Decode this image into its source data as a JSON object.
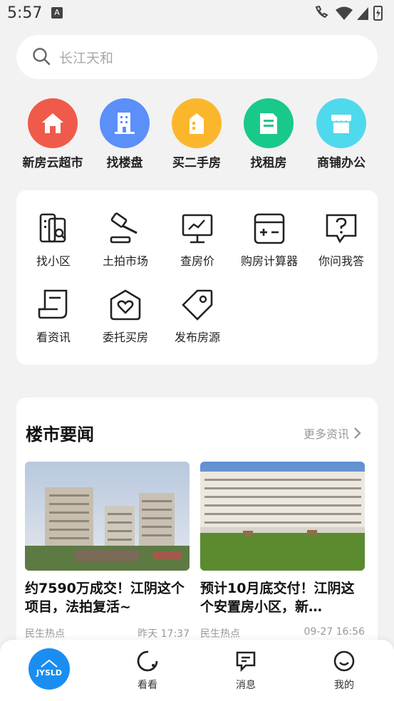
{
  "status_bar": {
    "time": "5:57",
    "notification_icon": "A"
  },
  "search": {
    "placeholder": "长江天和"
  },
  "main_nav": [
    {
      "label": "新房云超市",
      "icon": "house-icon",
      "color": "#f05a4a"
    },
    {
      "label": "找楼盘",
      "icon": "building-icon",
      "color": "#5b8ff9"
    },
    {
      "label": "买二手房",
      "icon": "secondhand-house-icon",
      "color": "#fbb72c"
    },
    {
      "label": "找租房",
      "icon": "rent-document-icon",
      "color": "#19c98a"
    },
    {
      "label": "商铺办公",
      "icon": "shop-icon",
      "color": "#4fd9ec"
    }
  ],
  "tools": [
    {
      "label": "找小区",
      "icon": "community-search-icon"
    },
    {
      "label": "土拍市场",
      "icon": "auction-gavel-icon"
    },
    {
      "label": "查房价",
      "icon": "price-chart-icon"
    },
    {
      "label": "购房计算器",
      "icon": "calculator-icon"
    },
    {
      "label": "你问我答",
      "icon": "question-icon"
    },
    {
      "label": "看资讯",
      "icon": "news-scroll-icon"
    },
    {
      "label": "委托买房",
      "icon": "heart-house-icon"
    },
    {
      "label": "发布房源",
      "icon": "tag-icon"
    }
  ],
  "news": {
    "title": "楼市要闻",
    "more": "更多资讯",
    "items": [
      {
        "headline": "约7590万成交！江阴这个项目，法拍复活~",
        "category": "民生热点",
        "time": "昨天 17:37"
      },
      {
        "headline": "预计10月底交付！江阴这个安置房小区，新…",
        "category": "民生热点",
        "time": "09-27 16:56"
      }
    ]
  },
  "bottom_nav": {
    "home_logo": "JYSLD",
    "tabs": [
      {
        "label": "看看",
        "icon": "look-icon"
      },
      {
        "label": "消息",
        "icon": "message-icon"
      },
      {
        "label": "我的",
        "icon": "profile-icon"
      }
    ]
  }
}
